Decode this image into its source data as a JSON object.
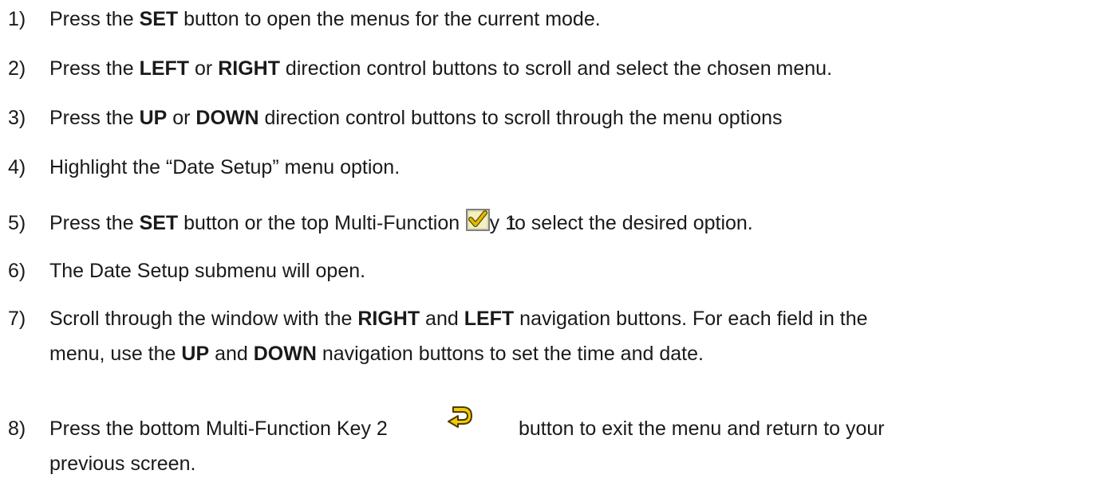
{
  "steps": [
    {
      "num": "1)",
      "parts": [
        "Press the ",
        "SET",
        " button to open the menus for the current mode."
      ]
    },
    {
      "num": "2)",
      "parts": [
        "Press the ",
        "LEFT",
        " or ",
        "RIGHT",
        " direction control buttons to scroll and select the chosen menu."
      ]
    },
    {
      "num": "3)",
      "parts": [
        "Press the ",
        "UP",
        " or ",
        "DOWN",
        " direction control buttons to scroll through the menu options"
      ]
    },
    {
      "num": "4)",
      "parts": [
        "Highlight the “Date Setup” menu option."
      ]
    },
    {
      "num": "5)",
      "parts": [
        "Press the ",
        "SET",
        " button or the top Multi-Function Key 1",
        "to select the desired option."
      ],
      "icon": "checkmark-icon"
    },
    {
      "num": "6)",
      "parts": [
        "The Date Setup submenu will open."
      ]
    },
    {
      "num": "7)",
      "parts": [
        "Scroll through the window with the ",
        "RIGHT",
        " and ",
        "LEFT",
        " navigation buttons. For each field in the"
      ],
      "continuation": [
        "menu, use the ",
        "UP",
        " and ",
        "DOWN",
        " navigation buttons to set the time and date."
      ]
    },
    {
      "num": "8)",
      "parts": [
        "Press the bottom Multi-Function Key 2",
        "button to exit the menu and return to your"
      ],
      "continuation": [
        "previous screen."
      ],
      "icon": "return-arrow-icon"
    }
  ],
  "colors": {
    "text": "#1a1a1a",
    "icon_border": "#808080",
    "icon_fill": "#f2f2c0",
    "check": "#d9a400",
    "arrow": "#e8c000"
  }
}
